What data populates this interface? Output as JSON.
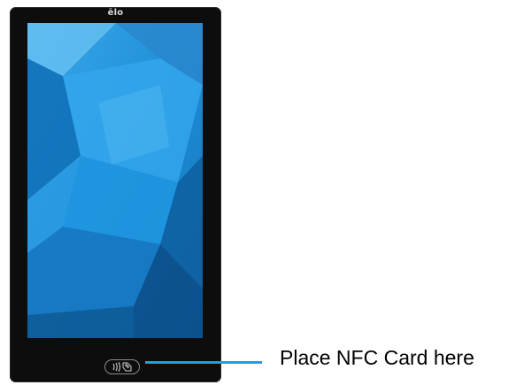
{
  "device": {
    "brand_logo_text": "ēlo",
    "nfc_icon": "contactless-nfc-icon",
    "screen_wallpaper": "blue-geometric-wallpaper"
  },
  "callout": {
    "label": "Place NFC Card here"
  },
  "colors": {
    "bezel": "#0d0d0d",
    "screen_base": "#1e8fd6",
    "pointer_line": "#1ba1e2",
    "logo": "#d8d8d8"
  }
}
